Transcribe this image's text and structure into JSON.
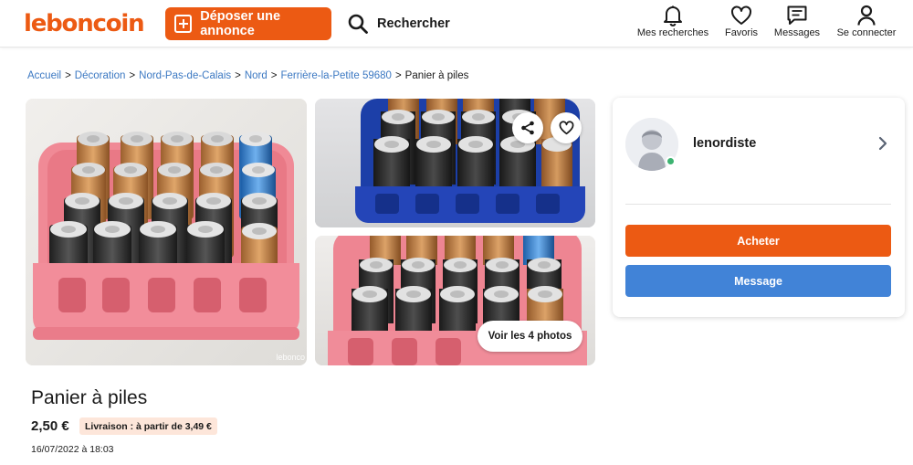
{
  "header": {
    "logo": "leboncoin",
    "deposit_label": "Déposer une annonce",
    "search_label": "Rechercher",
    "nav": {
      "searches": "Mes recherches",
      "favorites": "Favoris",
      "messages": "Messages",
      "login": "Se connecter"
    }
  },
  "breadcrumb": {
    "items": [
      "Accueil",
      "Décoration",
      "Nord-Pas-de-Calais",
      "Nord",
      "Ferrière-la-Petite 59680"
    ],
    "separator": ">",
    "current": "Panier à piles"
  },
  "gallery": {
    "watermark": "lebonco",
    "see_photos_label": "Voir les 4 photos",
    "icons": {
      "share": "share-icon",
      "favorite": "heart-icon"
    }
  },
  "seller": {
    "name": "lenordiste",
    "status_color": "#3cb371",
    "buy_label": "Acheter",
    "message_label": "Message"
  },
  "ad": {
    "title": "Panier à piles",
    "price": "2,50 €",
    "delivery": "Livraison : à partir de 3,49 €",
    "date": "16/07/2022 à 18:03"
  },
  "colors": {
    "brand": "#ec5a13",
    "link": "#3b78c2",
    "message_button": "#4183d7"
  }
}
